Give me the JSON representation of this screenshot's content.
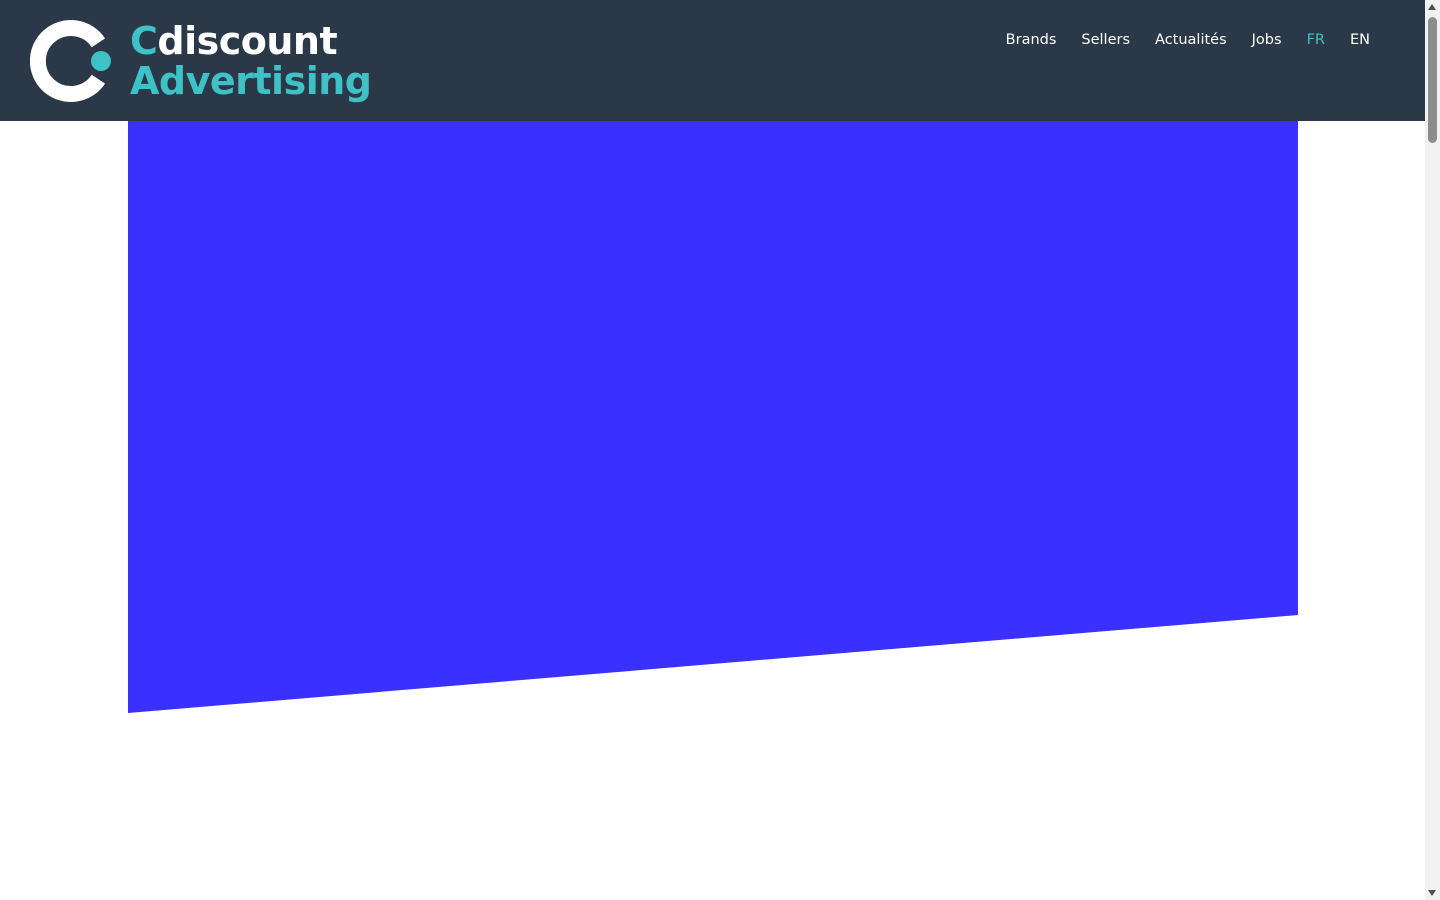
{
  "brand": {
    "name_first_letter": "C",
    "name_rest": "discount",
    "tagline": "Advertising",
    "colors": {
      "header_bg": "#2a3847",
      "accent": "#3ec1c7",
      "hero": "#3a30ff"
    }
  },
  "nav": {
    "items": [
      {
        "label": "Brands",
        "active": false
      },
      {
        "label": "Sellers",
        "active": false
      },
      {
        "label": "Actualités",
        "active": false
      },
      {
        "label": "Jobs",
        "active": false
      },
      {
        "label": "FR",
        "active": true
      },
      {
        "label": "EN",
        "active": false
      }
    ]
  },
  "icons": {
    "logo": "cdiscount-logo-icon",
    "scroll_up": "scroll-up-arrow-icon",
    "scroll_down": "scroll-down-arrow-icon"
  }
}
